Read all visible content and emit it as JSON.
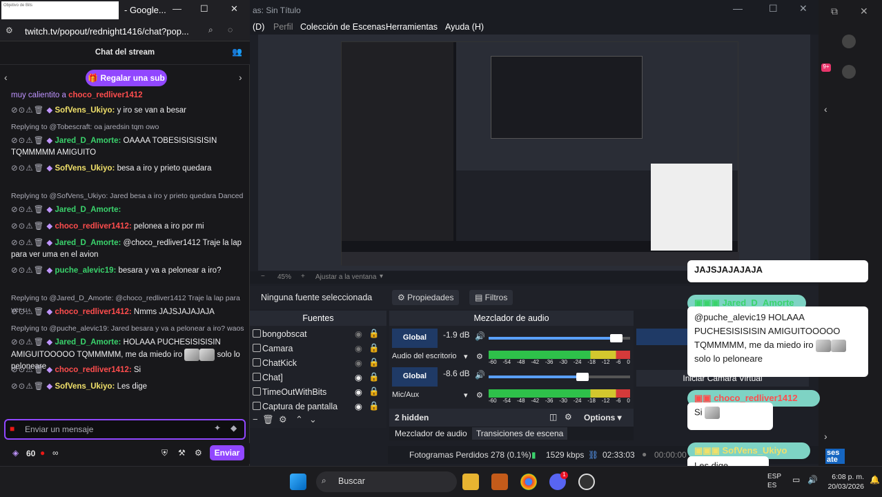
{
  "chat_window": {
    "title": "- Google...",
    "thumb_text": "Objetivo de Bits",
    "url": "twitch.tv/popout/rednight1416/chat?pop...",
    "header": "Chat del stream",
    "gift_button": "Regalar una sub",
    "top_partial": "muy calientito a",
    "top_partial_user": "choco_redliver1412",
    "messages": [
      {
        "user": "SofVens_Ukiyo:",
        "text": "y iro se van a besar",
        "color": "#f0e06a"
      },
      {
        "reply": "Replying to @Tobescraft: oa jaredsin tqm owo"
      },
      {
        "user": "Jared_D_Amorte:",
        "text": "OAAAA TOBESISISISISIN TQMMMMM AMIGUITO",
        "color": "#3ad36c"
      },
      {
        "user": "SofVens_Ukiyo:",
        "text": "besa a iro y prieto quedara",
        "color": "#f0e06a"
      },
      {
        "reply": "Replying to @SofVens_Ukiyo: Jared besa a iro y prieto quedara Danced"
      },
      {
        "user": "Jared_D_Amorte:",
        "text": "",
        "color": "#3ad36c"
      },
      {
        "user": "choco_redliver1412:",
        "text": "pelonea a iro por mi",
        "color": "#ff4d4d"
      },
      {
        "user": "Jared_D_Amorte:",
        "text": "@choco_redliver1412 Traje la lap para ver uma en el avion",
        "color": "#3ad36c"
      },
      {
        "user": "puche_alevic19:",
        "text": "besara y va a pelonear a iro?",
        "color": "#3ad36c"
      },
      {
        "reply": "Replying to @Jared_D_Amorte: @choco_redliver1412 Traje la lap para ver u"
      },
      {
        "user": "choco_redliver1412:",
        "text": "Nmms JAJSJAJAJAJA",
        "color": "#ff4d4d"
      },
      {
        "reply": "Replying to @puche_alevic19: Jared besara y va a pelonear a iro? waos"
      },
      {
        "user": "Jared_D_Amorte:",
        "text": "HOLAAA PUCHESISISISIN AMIGUITOOOOO TQMMMMM, me da miedo iro",
        "text2": "solo lo peloneare",
        "color": "#3ad36c"
      },
      {
        "user": "choco_redliver1412:",
        "text": "Si",
        "color": "#ff4d4d"
      },
      {
        "user": "SofVens_Ukiyo:",
        "text": "Les dige",
        "color": "#f0e06a"
      }
    ],
    "input_placeholder": "Enviar un mensaje",
    "points": "60",
    "infinity": "∞",
    "send_button": "Enviar"
  },
  "obs": {
    "title": "as: Sin Título",
    "menu": [
      "(D)",
      "Perfil",
      "Colección de Escenas",
      "Herramientas",
      "Ayuda (H)"
    ],
    "zoom": "45%",
    "fit": "Ajustar a la ventana",
    "no_source": "Ninguna fuente seleccionada",
    "properties": "Propiedades",
    "filters": "Filtros",
    "sources_title": "Fuentes",
    "sources": [
      "bongobscat",
      "Camara",
      "ChatKick",
      "Chat]",
      "TimeOutWithBits",
      "Captura de pantalla"
    ],
    "mixer_title": "Mezclador de audio",
    "channels": [
      {
        "name": "Audio del escritorio",
        "db": "-1.9 dB",
        "global": "Global",
        "level": 0.92
      },
      {
        "name": "Mic/Aux",
        "db": "-8.6 dB",
        "global": "Global",
        "level": 0.68
      }
    ],
    "meter_ticks": [
      "-60",
      "-54",
      "-48",
      "-42",
      "-36",
      "-30",
      "-24",
      "-18",
      "-12",
      "-6",
      "0"
    ],
    "hidden": "2 hidden",
    "options": "Options",
    "tab_mixer": "Mezclador de audio",
    "tab_transitions": "Transiciones de escena",
    "virtual_cam": "Iniciar Cámara Virtual",
    "status": {
      "dropped": "Fotogramas Perdidos 278 (0.1%)",
      "kbps": "1529 kbps",
      "time": "02:33:03",
      "time2": "00:00:00"
    }
  },
  "overlay": {
    "jajs": "JAJSJAJAJAJA",
    "bubbles": [
      {
        "user": "Jared_D_Amorte",
        "text": "@puche_alevic19 HOLAAA PUCHESISISISIN AMIGUITOOOOO TQMMMMM, me da miedo iro",
        "text2": "solo lo peloneare",
        "color": "#3ad36c"
      },
      {
        "user": "choco_redliver1412",
        "text": "Si",
        "color": "#ff4d4d"
      },
      {
        "user": "SofVens_Ukiyo",
        "text": "Les dige",
        "color": "#f0e06a"
      }
    ]
  },
  "taskbar": {
    "search": "Buscar",
    "lang": "ESP",
    "lang2": "ES",
    "time": "6:08 p. m.",
    "date": "20/03/2026",
    "discord_badge": "1"
  },
  "desk_partial": [
    "ses",
    "ate"
  ]
}
